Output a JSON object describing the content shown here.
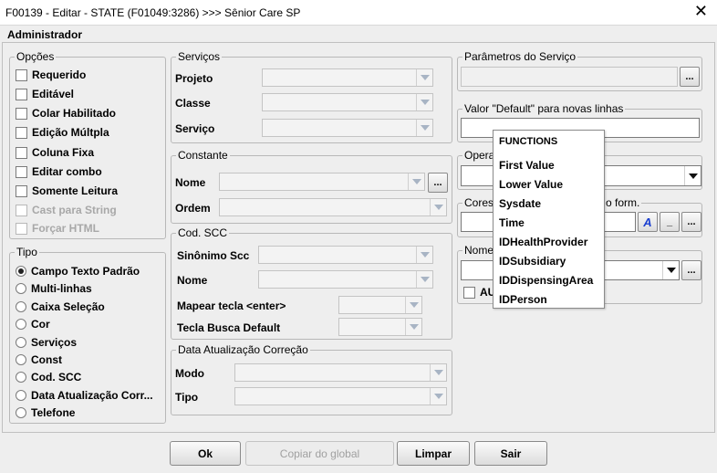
{
  "window": {
    "title": "F00139 - Editar - STATE (F01049:3286) >>> Sênior Care SP",
    "close_symbol": "✕",
    "user_label": "Administrador"
  },
  "opcoes": {
    "title": "Opções",
    "items": [
      {
        "label": "Requerido",
        "checked": false,
        "enabled": true
      },
      {
        "label": "Editável",
        "checked": false,
        "enabled": true
      },
      {
        "label": "Colar Habilitado",
        "checked": false,
        "enabled": true
      },
      {
        "label": "Edição Múltpla",
        "checked": false,
        "enabled": true
      },
      {
        "label": "Coluna Fixa",
        "checked": false,
        "enabled": true
      },
      {
        "label": "Editar combo",
        "checked": false,
        "enabled": true
      },
      {
        "label": "Somente Leitura",
        "checked": false,
        "enabled": true
      },
      {
        "label": "Cast para String",
        "checked": false,
        "enabled": false
      },
      {
        "label": "Forçar HTML",
        "checked": false,
        "enabled": false
      }
    ]
  },
  "tipo": {
    "title": "Tipo",
    "items": [
      {
        "label": "Campo Texto Padrão",
        "selected": true
      },
      {
        "label": "Multi-linhas",
        "selected": false
      },
      {
        "label": "Caixa Seleção",
        "selected": false
      },
      {
        "label": "Cor",
        "selected": false
      },
      {
        "label": "Serviços",
        "selected": false
      },
      {
        "label": "Const",
        "selected": false
      },
      {
        "label": "Cod. SCC",
        "selected": false
      },
      {
        "label": "Data Atualização Corr...",
        "selected": false
      },
      {
        "label": "Telefone",
        "selected": false
      }
    ]
  },
  "servicos": {
    "title": "Serviços",
    "projeto_label": "Projeto",
    "classe_label": "Classe",
    "servico_label": "Serviço"
  },
  "constante": {
    "title": "Constante",
    "nome_label": "Nome",
    "ordem_label": "Ordem",
    "browse_label": "..."
  },
  "cod_scc": {
    "title": "Cod. SCC",
    "sinonimo_label": "Sinônimo Scc",
    "nome_label": "Nome",
    "mapear_label": "Mapear tecla <enter>",
    "tecla_busca_label": "Tecla Busca Default"
  },
  "data_atualizacao": {
    "title": "Data Atualização Correção",
    "modo_label": "Modo",
    "tipo_label": "Tipo"
  },
  "parametros": {
    "title": "Parâmetros do Serviço",
    "browse_label": "..."
  },
  "valor_default": {
    "title": "Valor \"Default\" para novas linhas",
    "value": ""
  },
  "operacao": {
    "title_visible": "Opera"
  },
  "cores": {
    "title_left": "Cores",
    "title_right": "o form.",
    "italic_a_label": "A",
    "underline_label": "_",
    "browse_label": "..."
  },
  "nome_group": {
    "title_visible": "Nome",
    "checkbox_visible_label": "AU",
    "browse_label": "..."
  },
  "functions_popup": {
    "header": "FUNCTIONS",
    "items": [
      "First Value",
      "Lower Value",
      "Sysdate",
      "Time",
      "IDHealthProvider",
      "IDSubsidiary",
      "IDDispensingArea",
      "IDPerson"
    ]
  },
  "buttons": {
    "ok": "Ok",
    "copiar": "Copiar do global",
    "limpar": "Limpar",
    "sair": "Sair"
  },
  "colors": {
    "background": "#eeeeee",
    "italic_a": "#1a3fd0"
  }
}
